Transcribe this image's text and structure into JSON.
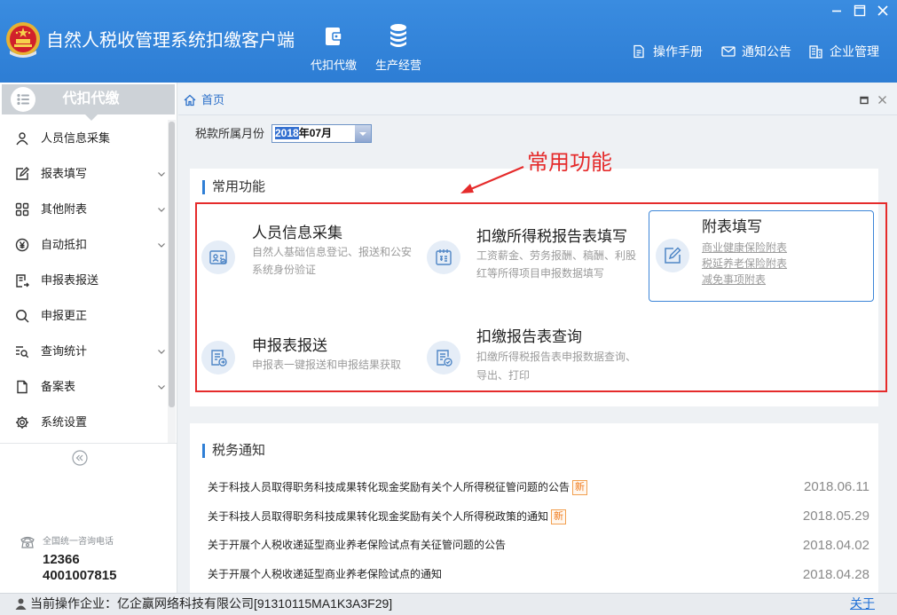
{
  "colors": {
    "header_bg": "#3185d9",
    "accent": "#2f7fd6",
    "annotation_red": "#e52b2b",
    "badge_orange": "#f07c1e",
    "link_blue": "#1e6fd6"
  },
  "window": {
    "controls": [
      "minimize-icon",
      "maximize-icon",
      "close-icon"
    ]
  },
  "header": {
    "title": "自然人税收管理系统扣缴客户端",
    "nav": [
      {
        "label": "代扣代缴",
        "icon": "wallet-icon"
      },
      {
        "label": "生产经营",
        "icon": "coins-icon"
      }
    ],
    "links": [
      {
        "label": "操作手册",
        "icon": "manual-icon"
      },
      {
        "label": "通知公告",
        "icon": "mail-icon"
      },
      {
        "label": "企业管理",
        "icon": "building-icon"
      }
    ]
  },
  "sidebar": {
    "title": "代扣代缴",
    "items": [
      {
        "label": "人员信息采集",
        "icon": "person-icon",
        "expandable": false
      },
      {
        "label": "报表填写",
        "icon": "edit-icon",
        "expandable": true
      },
      {
        "label": "其他附表",
        "icon": "grid-icon",
        "expandable": true
      },
      {
        "label": "自动抵扣",
        "icon": "yen-icon",
        "expandable": true
      },
      {
        "label": "申报表报送",
        "icon": "send-document-icon",
        "expandable": false
      },
      {
        "label": "申报更正",
        "icon": "search-icon",
        "expandable": false
      },
      {
        "label": "查询统计",
        "icon": "search-list-icon",
        "expandable": true
      },
      {
        "label": "备案表",
        "icon": "document-icon",
        "expandable": true
      },
      {
        "label": "系统设置",
        "icon": "gear-icon",
        "expandable": false
      }
    ],
    "hotline": {
      "label": "全国统一咨询电话",
      "numbers": [
        "12366",
        "4001007815"
      ]
    }
  },
  "tabs": [
    {
      "label": "首页",
      "icon": "home-icon",
      "active": true
    }
  ],
  "period": {
    "label": "税款所属月份",
    "value_selected": "2018",
    "value_rest": "年07月"
  },
  "annotation": {
    "text": "常用功能"
  },
  "functions": {
    "title": "常用功能",
    "cards": [
      {
        "title": "人员信息采集",
        "desc": [
          "自然人基础信息登记、报送和公安",
          "系统身份验证"
        ],
        "icon": "id-card-icon"
      },
      {
        "title": "扣缴所得税报告表填写",
        "desc": [
          "工资薪金、劳务报酬、稿酬、利股",
          "红等所得项目申报数据填写"
        ],
        "icon": "tax-form-icon"
      },
      {
        "title": "附表填写",
        "links": [
          "商业健康保险附表",
          "税延养老保险附表",
          "减免事项附表"
        ],
        "icon": "edit-icon",
        "highlighted": true
      },
      {
        "title": "申报表报送",
        "desc": [
          "申报表一键报送和申报结果获取"
        ],
        "icon": "send-document-icon"
      },
      {
        "title": "扣缴报告表查询",
        "desc": [
          "扣缴所得税报告表申报数据查询、",
          "导出、打印"
        ],
        "icon": "check-document-icon"
      }
    ]
  },
  "notices": {
    "title": "税务通知",
    "items": [
      {
        "text": "关于科技人员取得职务科技成果转化现金奖励有关个人所得税征管问题的公告",
        "badge": "新",
        "date": "2018.06.11"
      },
      {
        "text": "关于科技人员取得职务科技成果转化现金奖励有关个人所得税政策的通知",
        "badge": "新",
        "date": "2018.05.29"
      },
      {
        "text": "关于开展个人税收递延型商业养老保险试点有关征管问题的公告",
        "date": "2018.04.02"
      },
      {
        "text": "关于开展个人税收递延型商业养老保险试点的通知",
        "date": "2018.04.28"
      }
    ]
  },
  "status": {
    "text": "当前操作企业：亿企赢网络科技有限公司[91310115MA1K3A3F29]",
    "about": "关于"
  }
}
